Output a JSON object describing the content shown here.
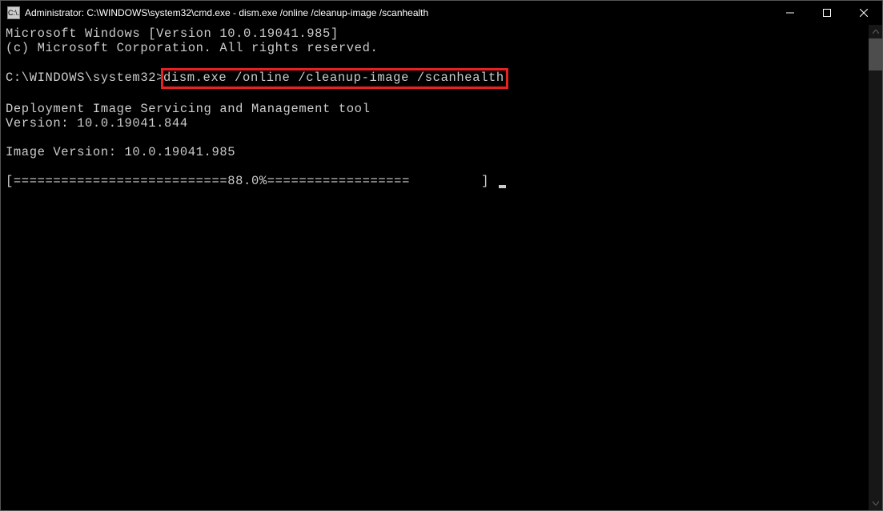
{
  "window": {
    "title": "Administrator: C:\\WINDOWS\\system32\\cmd.exe - dism.exe  /online /cleanup-image /scanhealth",
    "icon_label": "C:\\."
  },
  "terminal": {
    "line1": "Microsoft Windows [Version 10.0.19041.985]",
    "line2": "(c) Microsoft Corporation. All rights reserved.",
    "blank1": "",
    "prompt_prefix": "C:\\WINDOWS\\system32>",
    "command": "dism.exe /online /cleanup-image /scanhealth",
    "blank2": "",
    "tool_line1": "Deployment Image Servicing and Management tool",
    "tool_line2": "Version: 10.0.19041.844",
    "blank3": "",
    "img_line": "Image Version: 10.0.19041.985",
    "blank4": "",
    "progress": "[===========================88.0%==================         ] "
  }
}
